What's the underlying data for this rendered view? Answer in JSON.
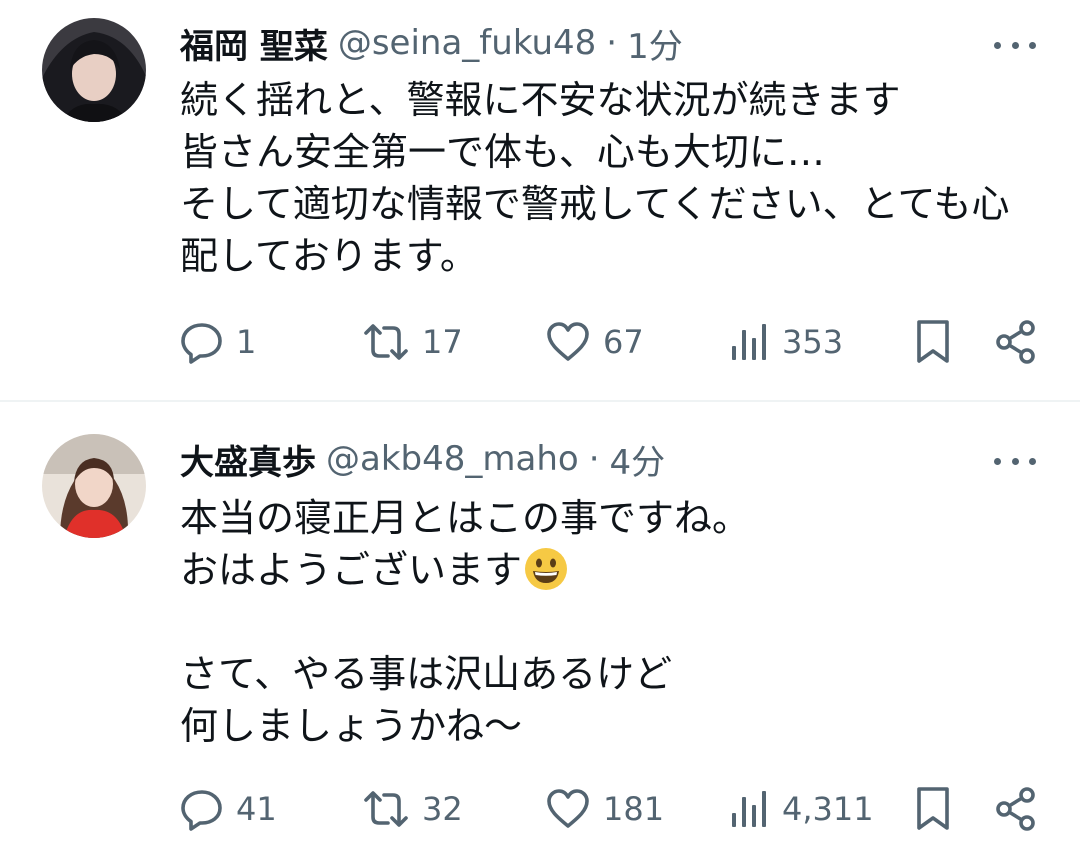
{
  "tweets": [
    {
      "display_name": "福岡 聖菜",
      "handle": "@seina_fuku48",
      "separator": "·",
      "time": "1分",
      "lines": [
        "続く揺れと、警報に不安な状況が続きます",
        "皆さん安全第一で体も、心も大切に…",
        "そして適切な情報で警戒してください、とても心",
        "配しております。"
      ],
      "replies": "1",
      "retweets": "17",
      "likes": "67",
      "views": "353"
    },
    {
      "display_name": "大盛真歩",
      "handle": "@akb48_maho",
      "separator": "·",
      "time": "4分",
      "lines": [
        "本当の寝正月とはこの事ですね。",
        "おはようございます",
        "",
        "さて、やる事は沢山あるけど",
        "何しましょうかね〜"
      ],
      "emoji": "grinning-face-emoji",
      "replies": "41",
      "retweets": "32",
      "likes": "181",
      "views": "4,311"
    }
  ],
  "icons": {
    "more": "more-dots-icon",
    "reply": "reply-icon",
    "retweet": "retweet-icon",
    "like": "heart-icon",
    "views": "views-icon",
    "bookmark": "bookmark-icon",
    "share": "share-icon"
  },
  "colors": {
    "text": "#0f1419",
    "secondary": "#536471",
    "divider": "#eff3f4",
    "emoji_yellow": "#f6c944"
  }
}
